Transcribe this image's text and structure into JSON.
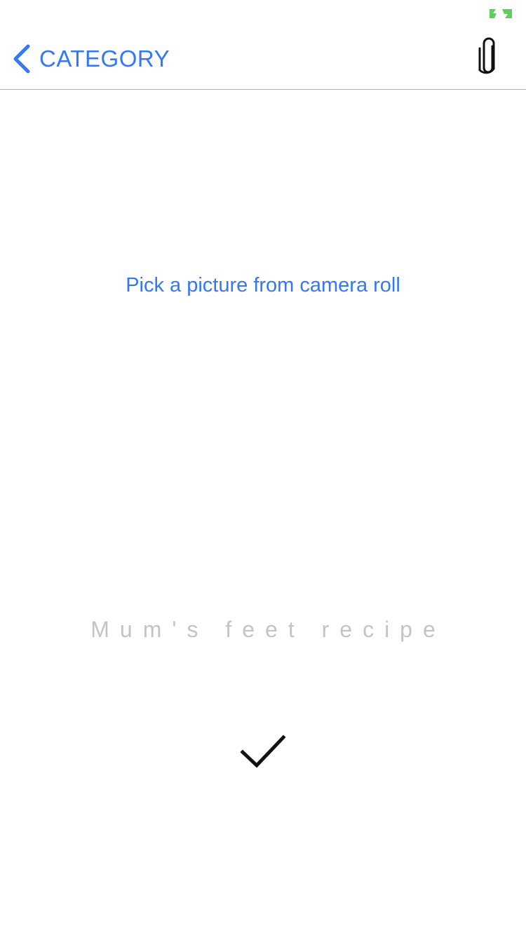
{
  "status_bar": {
    "battery_icon": "battery-charging-icon",
    "battery_color": "#5fcf5b"
  },
  "nav": {
    "back_icon": "chevron-left-icon",
    "back_label": "CATEGORY",
    "attach_icon": "paperclip-icon"
  },
  "main": {
    "pick_picture_label": "Pick a picture from camera roll",
    "recipe_title": "Mum's feet recipe",
    "confirm_icon": "checkmark-icon"
  },
  "colors": {
    "accent": "#3478f6",
    "title_placeholder": "#c4c4c4",
    "divider": "#b2b2b2"
  }
}
